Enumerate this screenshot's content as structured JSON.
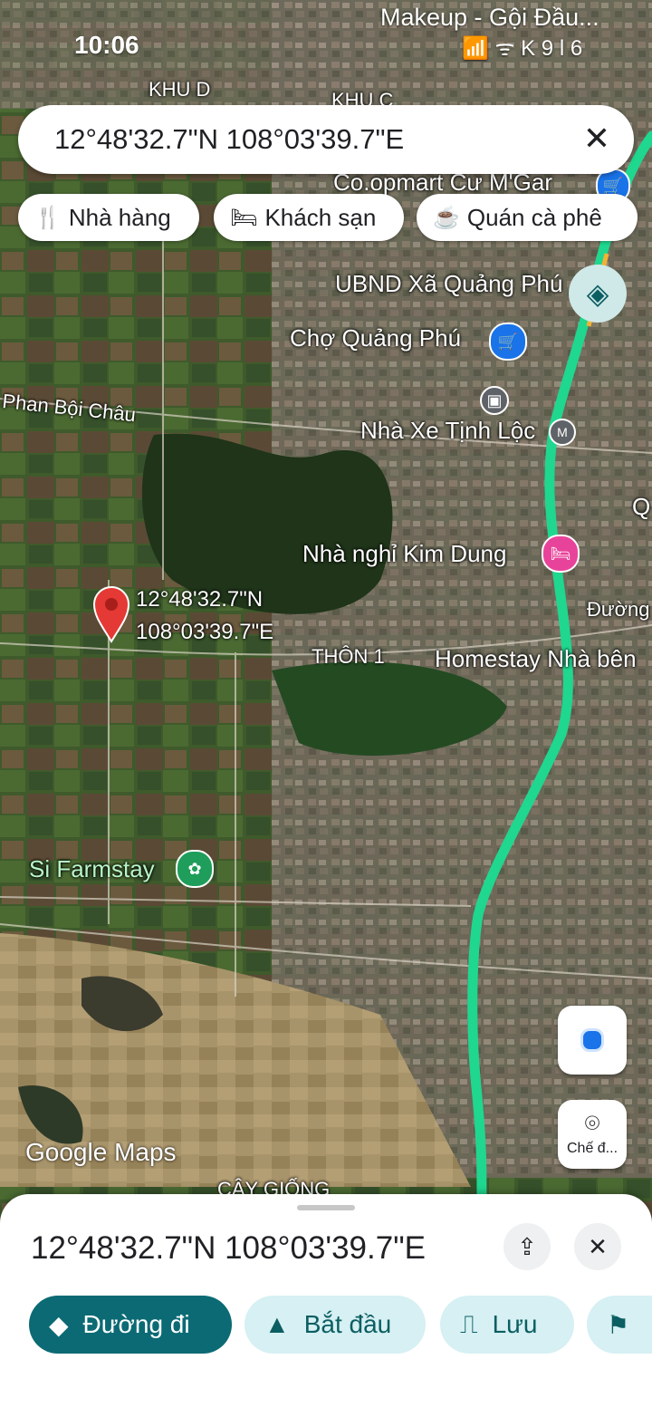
{
  "status_bar": {
    "time": "10:06",
    "notification": "Makeup - Gội Đầu...",
    "icons": "📶 ᯤ K 9 l 6"
  },
  "search": {
    "query": "12°48'32.7\"N 108°03'39.7\"E",
    "clear_icon": "close-icon"
  },
  "categories": [
    {
      "label": "Nhà hàng",
      "icon": "utensils-icon"
    },
    {
      "label": "Khách sạn",
      "icon": "bed-icon"
    },
    {
      "label": "Quán cà phê",
      "icon": "coffee-icon"
    }
  ],
  "map": {
    "labels": {
      "khu_d": "KHU D",
      "khu_c": "KHU C",
      "coopmart": "Co.opmart Cư M'Gar",
      "ubnd": "UBND Xã Quảng Phú",
      "cho": "Chợ Quảng Phú",
      "phan_boi_chau": "Phan Bội Châu",
      "nha_xe": "Nhà Xe Tịnh Lộc",
      "nha_nghi": "Nhà nghỉ Kim Dung",
      "duong": "Đường",
      "thon1": "THÔN 1",
      "homestay": "Homestay Nhà bên",
      "farmstay": "Si Farmstay",
      "cay_giong": "CÂY GIỐNG",
      "q": "Q"
    },
    "pin_label_line1": "12°48'32.7\"N",
    "pin_label_line2": "108°03'39.7\"E",
    "google_logo": "Google Maps",
    "lens_label": "Chế đ..."
  },
  "sheet": {
    "coords": "12°48'32.7\"N 108°03'39.7\"E",
    "actions": [
      {
        "label": "Đường đi",
        "icon": "directions-icon"
      },
      {
        "label": "Bắt đầu",
        "icon": "navigation-arrow-icon"
      },
      {
        "label": "Lưu",
        "icon": "bookmark-icon"
      }
    ]
  },
  "colors": {
    "route": "#1fd78f",
    "primary": "#0b6a74",
    "secondary": "#d6f0f3",
    "pin": "#e53935"
  }
}
